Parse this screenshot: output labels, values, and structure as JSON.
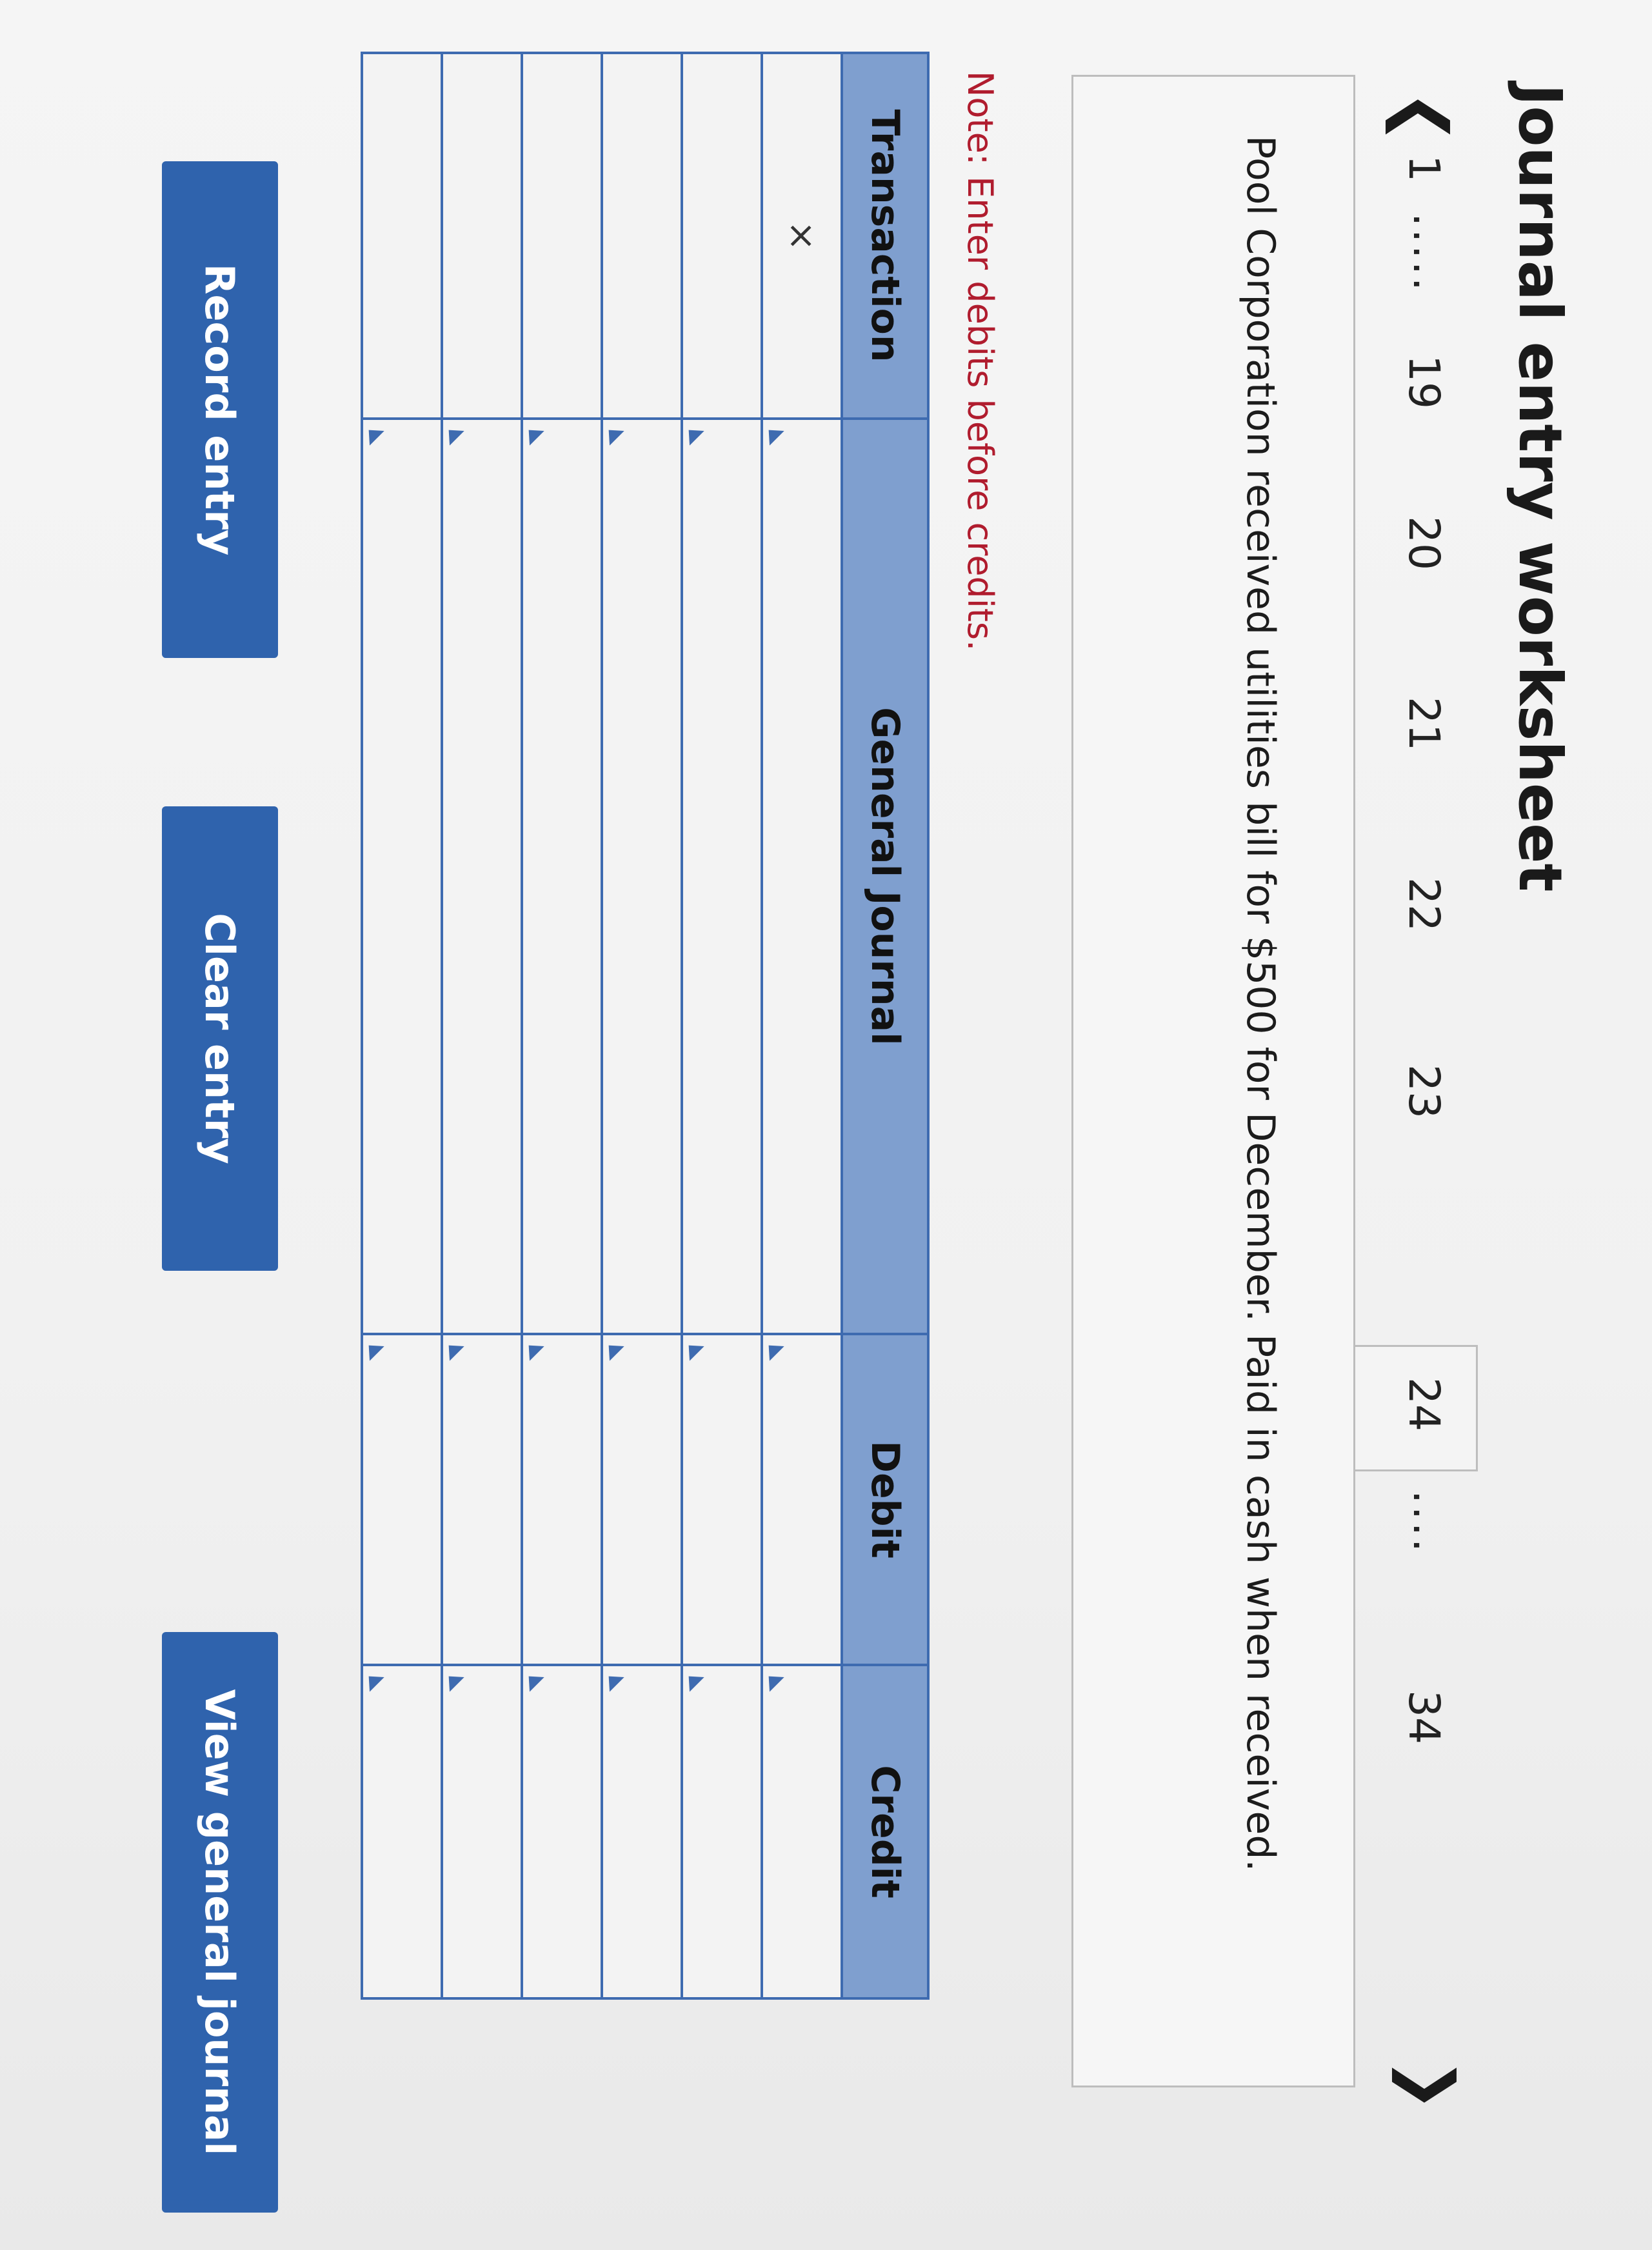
{
  "title": "Journal entry worksheet",
  "pager": {
    "items": [
      "1",
      ".....",
      "19",
      "20",
      "21",
      "22",
      "23",
      "24",
      "....",
      "34"
    ],
    "active": "24"
  },
  "question": "Pool Corporation received utilities bill for $500 for December. Paid in cash when received.",
  "note": "Note: Enter debits before credits.",
  "table": {
    "headers": [
      "Transaction",
      "General Journal",
      "Debit",
      "Credit"
    ],
    "rows": [
      {
        "transaction": "×",
        "journal": "",
        "debit": "",
        "credit": ""
      },
      {
        "transaction": "",
        "journal": "",
        "debit": "",
        "credit": ""
      },
      {
        "transaction": "",
        "journal": "",
        "debit": "",
        "credit": ""
      },
      {
        "transaction": "",
        "journal": "",
        "debit": "",
        "credit": ""
      },
      {
        "transaction": "",
        "journal": "",
        "debit": "",
        "credit": ""
      },
      {
        "transaction": "",
        "journal": "",
        "debit": "",
        "credit": ""
      }
    ]
  },
  "buttons": {
    "record": "Record entry",
    "clear": "Clear entry",
    "view": "View general journal"
  },
  "colors": {
    "header_bg": "#7f9fcf",
    "border": "#3e6bb0",
    "button_bg": "#2f63ad",
    "note_text": "#b01c2e"
  }
}
